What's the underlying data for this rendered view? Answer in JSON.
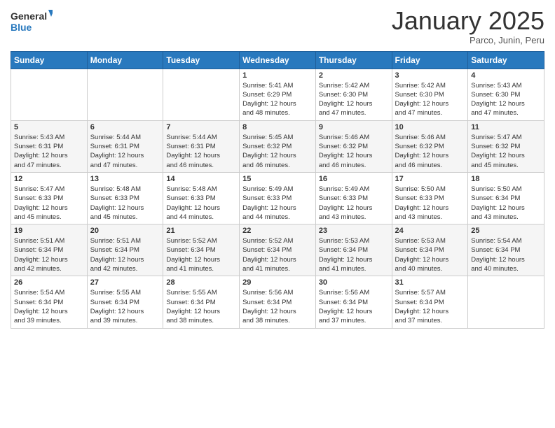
{
  "header": {
    "logo_line1": "General",
    "logo_line2": "Blue",
    "month": "January 2025",
    "location": "Parco, Junin, Peru"
  },
  "days_of_week": [
    "Sunday",
    "Monday",
    "Tuesday",
    "Wednesday",
    "Thursday",
    "Friday",
    "Saturday"
  ],
  "weeks": [
    [
      {
        "day": "",
        "info": ""
      },
      {
        "day": "",
        "info": ""
      },
      {
        "day": "",
        "info": ""
      },
      {
        "day": "1",
        "info": "Sunrise: 5:41 AM\nSunset: 6:29 PM\nDaylight: 12 hours\nand 48 minutes."
      },
      {
        "day": "2",
        "info": "Sunrise: 5:42 AM\nSunset: 6:30 PM\nDaylight: 12 hours\nand 47 minutes."
      },
      {
        "day": "3",
        "info": "Sunrise: 5:42 AM\nSunset: 6:30 PM\nDaylight: 12 hours\nand 47 minutes."
      },
      {
        "day": "4",
        "info": "Sunrise: 5:43 AM\nSunset: 6:30 PM\nDaylight: 12 hours\nand 47 minutes."
      }
    ],
    [
      {
        "day": "5",
        "info": "Sunrise: 5:43 AM\nSunset: 6:31 PM\nDaylight: 12 hours\nand 47 minutes."
      },
      {
        "day": "6",
        "info": "Sunrise: 5:44 AM\nSunset: 6:31 PM\nDaylight: 12 hours\nand 47 minutes."
      },
      {
        "day": "7",
        "info": "Sunrise: 5:44 AM\nSunset: 6:31 PM\nDaylight: 12 hours\nand 46 minutes."
      },
      {
        "day": "8",
        "info": "Sunrise: 5:45 AM\nSunset: 6:32 PM\nDaylight: 12 hours\nand 46 minutes."
      },
      {
        "day": "9",
        "info": "Sunrise: 5:46 AM\nSunset: 6:32 PM\nDaylight: 12 hours\nand 46 minutes."
      },
      {
        "day": "10",
        "info": "Sunrise: 5:46 AM\nSunset: 6:32 PM\nDaylight: 12 hours\nand 46 minutes."
      },
      {
        "day": "11",
        "info": "Sunrise: 5:47 AM\nSunset: 6:32 PM\nDaylight: 12 hours\nand 45 minutes."
      }
    ],
    [
      {
        "day": "12",
        "info": "Sunrise: 5:47 AM\nSunset: 6:33 PM\nDaylight: 12 hours\nand 45 minutes."
      },
      {
        "day": "13",
        "info": "Sunrise: 5:48 AM\nSunset: 6:33 PM\nDaylight: 12 hours\nand 45 minutes."
      },
      {
        "day": "14",
        "info": "Sunrise: 5:48 AM\nSunset: 6:33 PM\nDaylight: 12 hours\nand 44 minutes."
      },
      {
        "day": "15",
        "info": "Sunrise: 5:49 AM\nSunset: 6:33 PM\nDaylight: 12 hours\nand 44 minutes."
      },
      {
        "day": "16",
        "info": "Sunrise: 5:49 AM\nSunset: 6:33 PM\nDaylight: 12 hours\nand 43 minutes."
      },
      {
        "day": "17",
        "info": "Sunrise: 5:50 AM\nSunset: 6:33 PM\nDaylight: 12 hours\nand 43 minutes."
      },
      {
        "day": "18",
        "info": "Sunrise: 5:50 AM\nSunset: 6:34 PM\nDaylight: 12 hours\nand 43 minutes."
      }
    ],
    [
      {
        "day": "19",
        "info": "Sunrise: 5:51 AM\nSunset: 6:34 PM\nDaylight: 12 hours\nand 42 minutes."
      },
      {
        "day": "20",
        "info": "Sunrise: 5:51 AM\nSunset: 6:34 PM\nDaylight: 12 hours\nand 42 minutes."
      },
      {
        "day": "21",
        "info": "Sunrise: 5:52 AM\nSunset: 6:34 PM\nDaylight: 12 hours\nand 41 minutes."
      },
      {
        "day": "22",
        "info": "Sunrise: 5:52 AM\nSunset: 6:34 PM\nDaylight: 12 hours\nand 41 minutes."
      },
      {
        "day": "23",
        "info": "Sunrise: 5:53 AM\nSunset: 6:34 PM\nDaylight: 12 hours\nand 41 minutes."
      },
      {
        "day": "24",
        "info": "Sunrise: 5:53 AM\nSunset: 6:34 PM\nDaylight: 12 hours\nand 40 minutes."
      },
      {
        "day": "25",
        "info": "Sunrise: 5:54 AM\nSunset: 6:34 PM\nDaylight: 12 hours\nand 40 minutes."
      }
    ],
    [
      {
        "day": "26",
        "info": "Sunrise: 5:54 AM\nSunset: 6:34 PM\nDaylight: 12 hours\nand 39 minutes."
      },
      {
        "day": "27",
        "info": "Sunrise: 5:55 AM\nSunset: 6:34 PM\nDaylight: 12 hours\nand 39 minutes."
      },
      {
        "day": "28",
        "info": "Sunrise: 5:55 AM\nSunset: 6:34 PM\nDaylight: 12 hours\nand 38 minutes."
      },
      {
        "day": "29",
        "info": "Sunrise: 5:56 AM\nSunset: 6:34 PM\nDaylight: 12 hours\nand 38 minutes."
      },
      {
        "day": "30",
        "info": "Sunrise: 5:56 AM\nSunset: 6:34 PM\nDaylight: 12 hours\nand 37 minutes."
      },
      {
        "day": "31",
        "info": "Sunrise: 5:57 AM\nSunset: 6:34 PM\nDaylight: 12 hours\nand 37 minutes."
      },
      {
        "day": "",
        "info": ""
      }
    ]
  ]
}
